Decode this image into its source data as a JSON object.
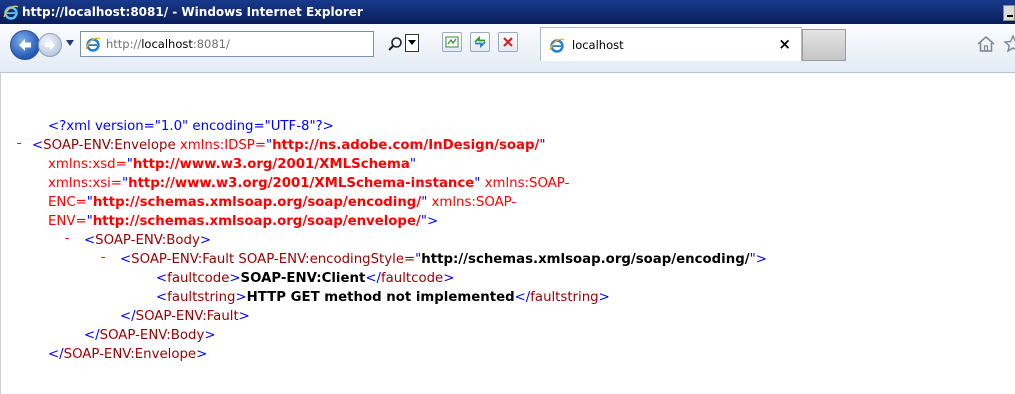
{
  "window": {
    "title": "http://localhost:8081/ - Windows Internet Explorer"
  },
  "toolbar": {
    "address_scheme": "http://",
    "address_host": "localhost",
    "address_rest": ":8081/",
    "tab_label": "localhost",
    "tab_close": "×"
  },
  "xml": {
    "decl": "<?xml version=\"1.0\" encoding=\"UTF-8\"?>",
    "dash": "-",
    "lt": "<",
    "gt": ">",
    "close_lt": "</",
    "envelope_tag": "SOAP-ENV:Envelope",
    "attr_idsp_name": " xmlns:IDSP=",
    "attr_idsp_value": "http://ns.adobe.com/InDesign/soap/",
    "attr_xsd_name": "xmlns:xsd=",
    "attr_xsd_value": "http://www.w3.org/2001/XMLSchema",
    "attr_xsi_name": "xmlns:xsi=",
    "attr_xsi_value": "http://www.w3.org/2001/XMLSchema-instance",
    "attr_enc_name_a": " xmlns:SOAP-",
    "attr_enc_name_b": "ENC=",
    "attr_enc_value": "http://schemas.xmlsoap.org/soap/encoding/",
    "attr_env_name_a": " xmlns:SOAP-",
    "attr_env_name_b": "ENV=",
    "attr_env_value": "http://schemas.xmlsoap.org/soap/envelope/",
    "quote": "\"",
    "body_tag": "SOAP-ENV:Body",
    "fault_tag": "SOAP-ENV:Fault",
    "fault_attr_name": " SOAP-ENV:encodingStyle=",
    "fault_attr_value": "http://schemas.xmlsoap.org/soap/encoding/",
    "faultcode_tag": "faultcode",
    "faultcode_value": "SOAP-ENV:Client",
    "faultstring_tag": "faultstring",
    "faultstring_value": "HTTP GET method not implemented"
  }
}
